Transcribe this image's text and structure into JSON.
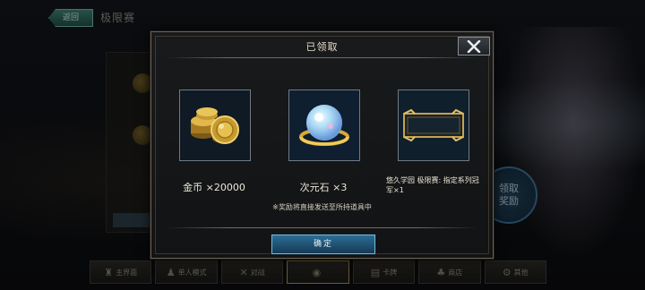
{
  "background": {
    "back_button": "返回",
    "title": "极限赛",
    "claim_button": "领取\n奖励"
  },
  "bottom_tabs": [
    {
      "label": "主界面",
      "icon": "castle-icon",
      "active": false
    },
    {
      "label": "单人模式",
      "icon": "person-icon",
      "active": false
    },
    {
      "label": "对战",
      "icon": "crossed-swords-icon",
      "active": false
    },
    {
      "label": "",
      "icon": "medal-icon",
      "active": true
    },
    {
      "label": "卡牌",
      "icon": "cards-icon",
      "active": false
    },
    {
      "label": "商店",
      "icon": "shop-icon",
      "active": false
    },
    {
      "label": "其他",
      "icon": "gear-icon",
      "active": false
    }
  ],
  "modal": {
    "title": "已领取",
    "close_icon": "close-x-icon",
    "rewards": [
      {
        "name": "金币",
        "qty_text": "金币 ×20000",
        "icon": "gold-coins-icon"
      },
      {
        "name": "次元石",
        "qty_text": "次元石 ×3",
        "icon": "crystal-orb-icon"
      },
      {
        "name": "冠军头像框",
        "qty_text": "悠久学园 极限赛: 指定系列冠军×1",
        "icon": "frame-icon"
      }
    ],
    "notice": "※奖励将直接发送至所持道具中",
    "confirm_label": "确定"
  },
  "colors": {
    "accent_blue": "#2c6d93",
    "gold": "#c9a24a",
    "border": "#6d6250"
  }
}
